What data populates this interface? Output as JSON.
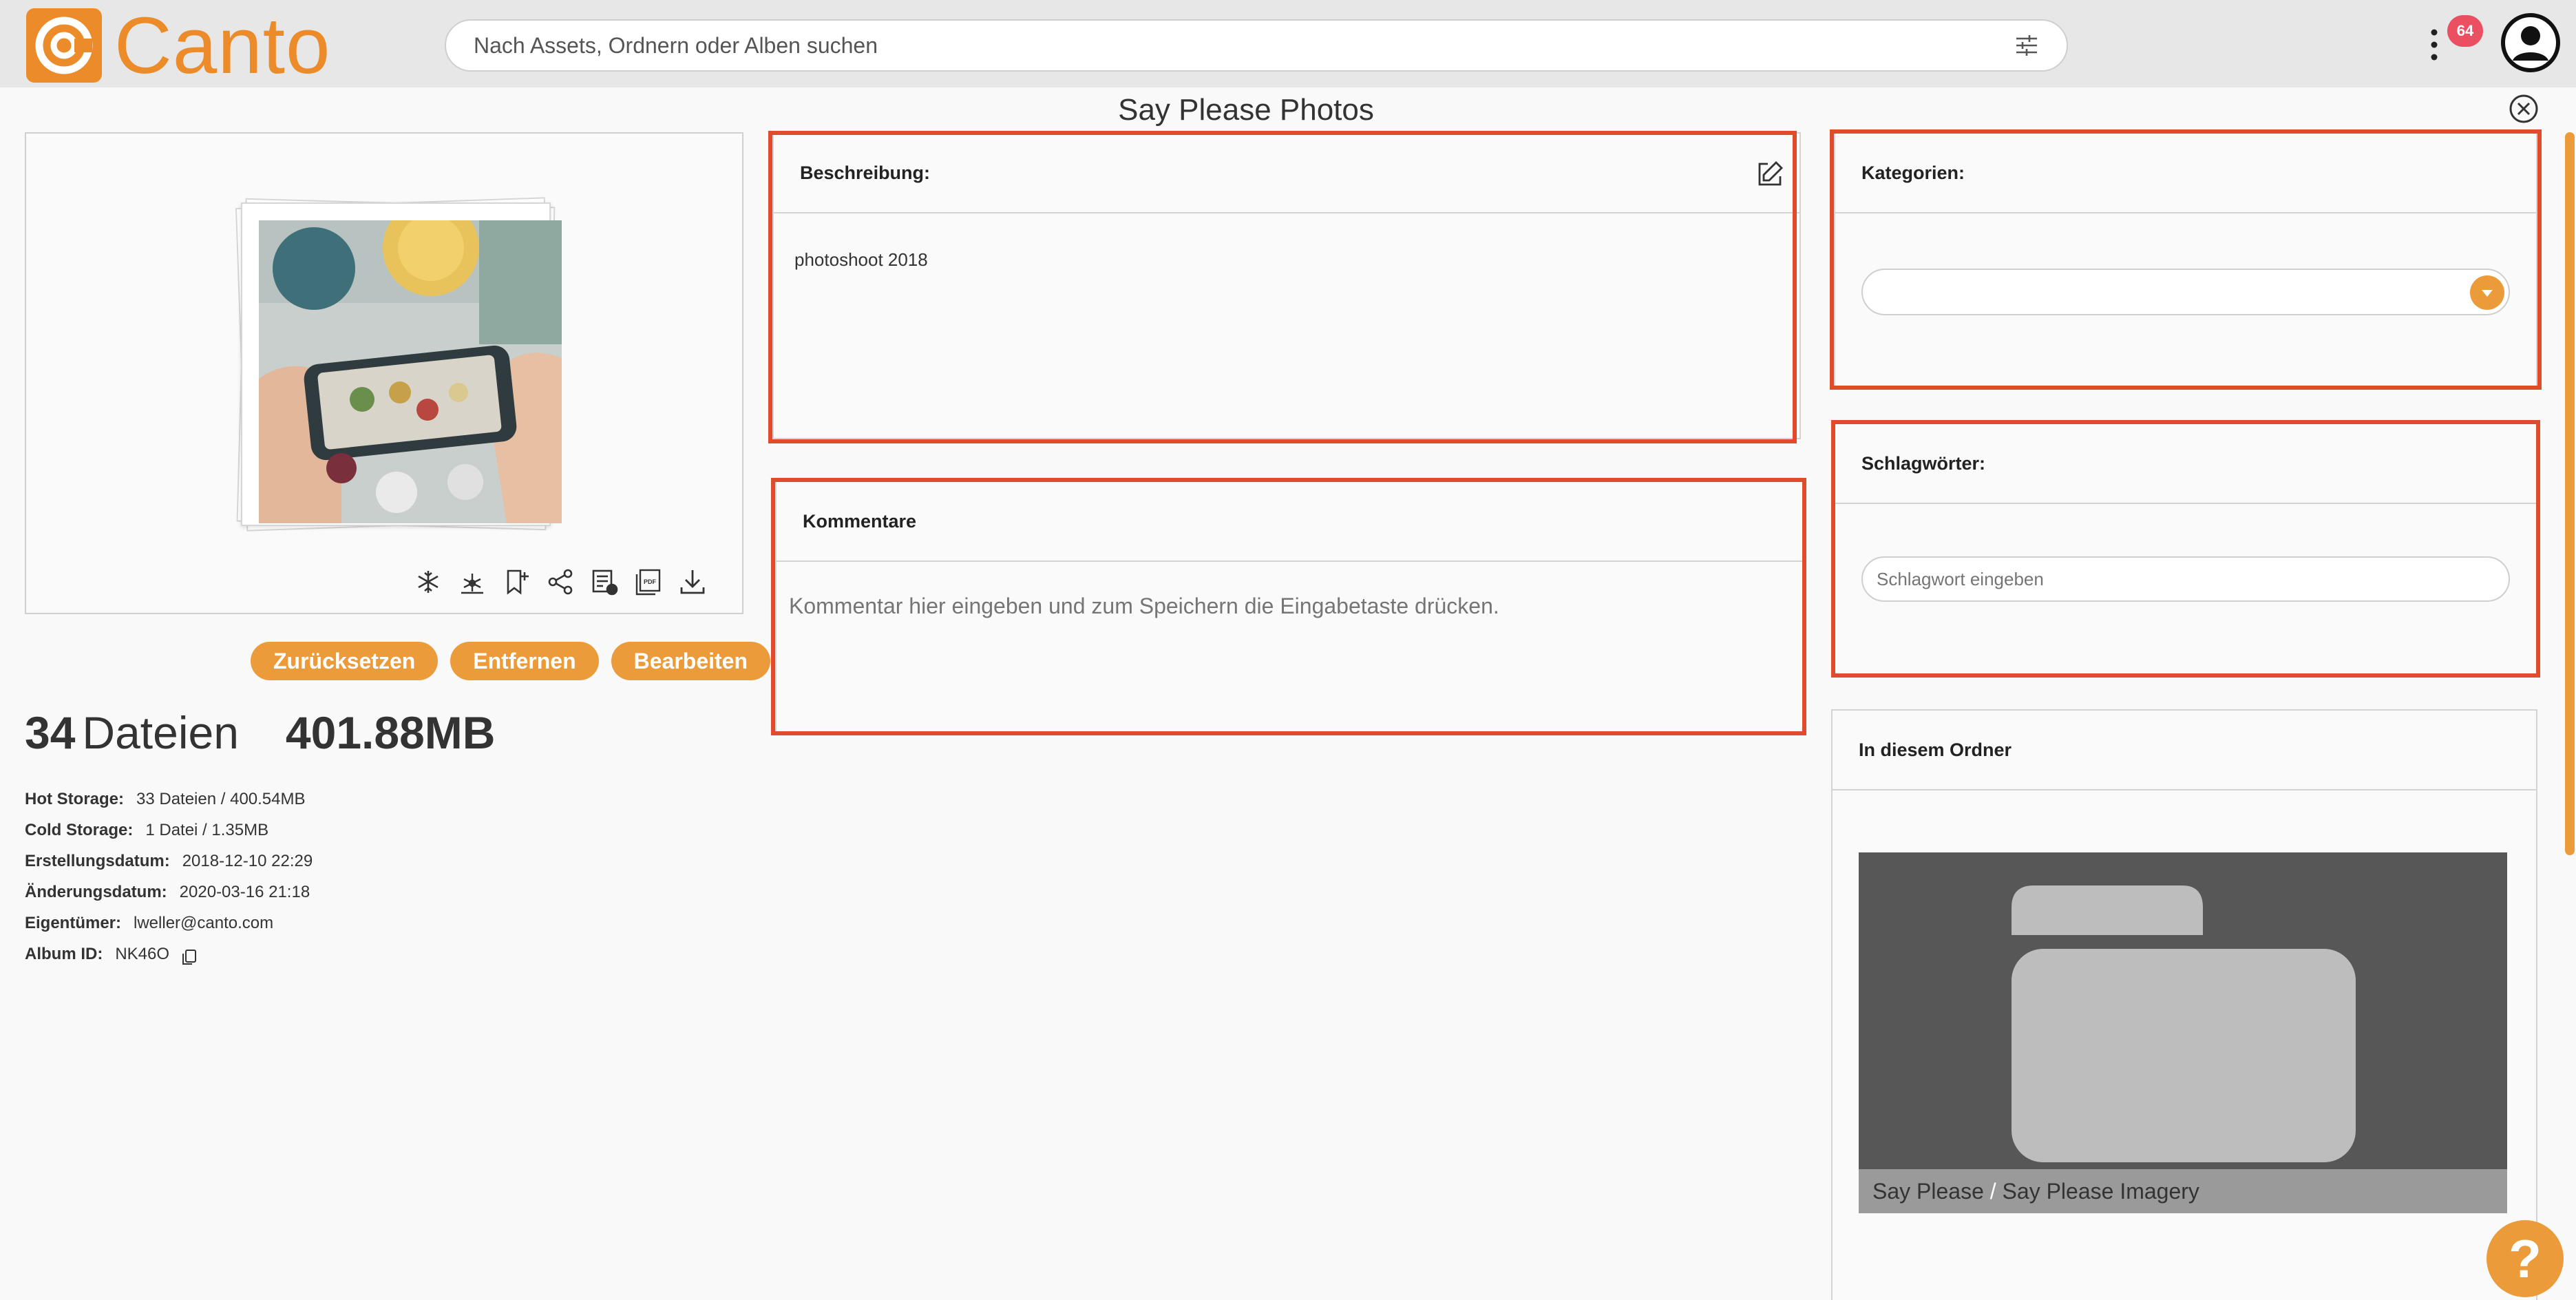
{
  "app": {
    "brand": "Canto",
    "brand_color": "#ec8b2a",
    "accent_color": "#ec9b3b",
    "annotation_color": "#e04b2b"
  },
  "header": {
    "search_placeholder": "Nach Assets, Ordnern oder Alben suchen",
    "notification_count": "64",
    "icons": [
      "filter-sliders-icon",
      "kebab-menu-icon",
      "user-avatar-icon"
    ]
  },
  "page": {
    "title": "Say Please Photos"
  },
  "preview": {
    "toolbar_icons": [
      "snowflake-icon",
      "snowflake-outline-icon",
      "bookmark-add-icon",
      "share-icon",
      "list-settings-icon",
      "pdf-icon",
      "download-icon"
    ],
    "buttons": {
      "reset": "Zurücksetzen",
      "remove": "Entfernen",
      "edit": "Bearbeiten"
    }
  },
  "summary": {
    "file_count": "34",
    "file_label": "Dateien",
    "total_size": "401.88MB"
  },
  "meta": [
    {
      "key": "Hot Storage:",
      "value": "33 Dateien / 400.54MB"
    },
    {
      "key": "Cold Storage:",
      "value": "1 Datei / 1.35MB"
    },
    {
      "key": "Erstellungsdatum:",
      "value": "2018-12-10 22:29"
    },
    {
      "key": "Änderungsdatum:",
      "value": "2020-03-16 21:18"
    },
    {
      "key": "Eigentümer:",
      "value": "lweller@canto.com"
    },
    {
      "key": "Album ID:",
      "value": "NK46O"
    }
  ],
  "description": {
    "heading": "Beschreibung:",
    "text": "photoshoot 2018"
  },
  "comments": {
    "heading": "Kommentare",
    "placeholder": "Kommentar hier eingeben und zum Speichern die Eingabetaste drücken."
  },
  "categories": {
    "heading": "Kategorien:"
  },
  "keywords": {
    "heading": "Schlagwörter:",
    "placeholder": "Schlagwort eingeben"
  },
  "folder": {
    "heading": "In diesem Ordner",
    "path_root": "Say Please",
    "path_sep": "/",
    "path_child": "Say Please Imagery"
  },
  "help": {
    "label": "?"
  }
}
